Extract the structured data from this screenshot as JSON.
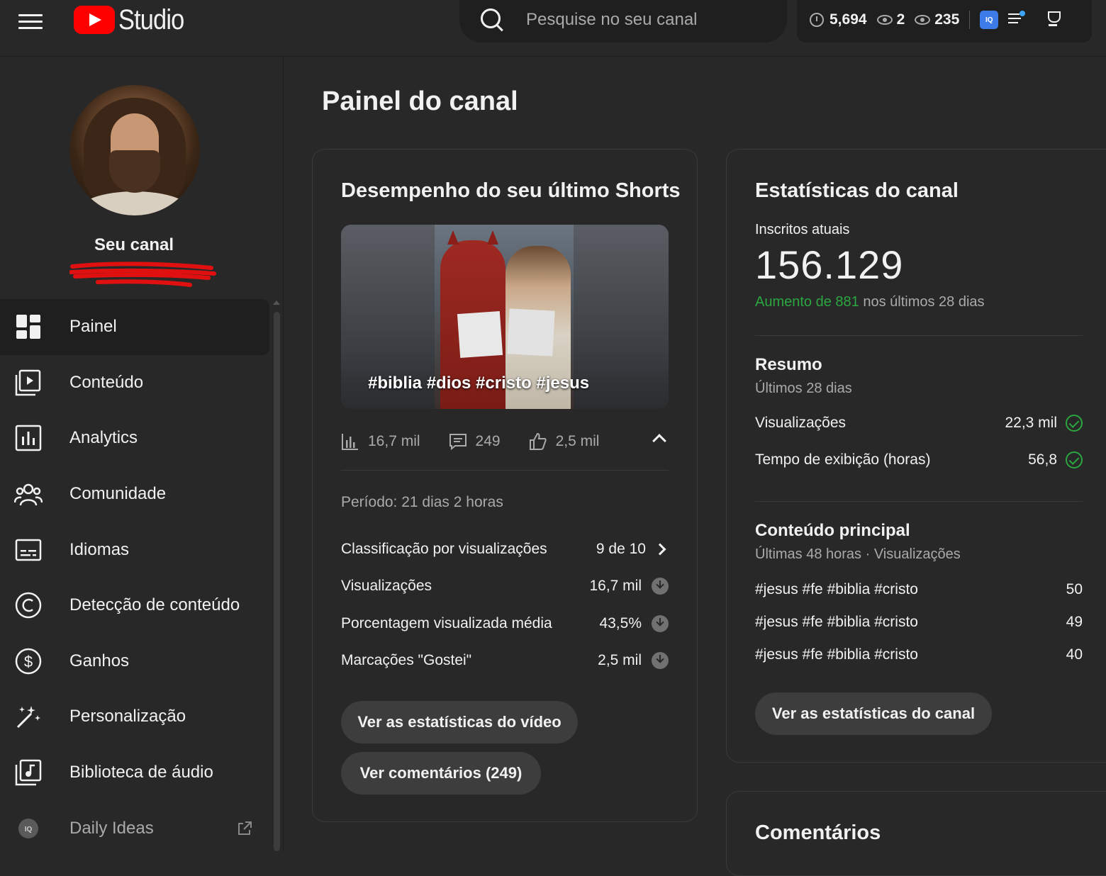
{
  "header": {
    "logo_text": "Studio",
    "search_placeholder": "Pesquise no seu canal",
    "stats": {
      "watch_hours": "5,694",
      "live_viewers": "2",
      "views": "235"
    },
    "iq_badge": "IQ"
  },
  "sidebar": {
    "channel_label": "Seu canal",
    "items": [
      {
        "label": "Painel",
        "icon": "dashboard-icon",
        "active": true
      },
      {
        "label": "Conteúdo",
        "icon": "content-icon"
      },
      {
        "label": "Analytics",
        "icon": "analytics-icon"
      },
      {
        "label": "Comunidade",
        "icon": "community-icon"
      },
      {
        "label": "Idiomas",
        "icon": "subtitles-icon"
      },
      {
        "label": "Detecção de conteúdo",
        "icon": "copyright-icon"
      },
      {
        "label": "Ganhos",
        "icon": "dollar-icon"
      },
      {
        "label": "Personalização",
        "icon": "magic-wand-icon"
      },
      {
        "label": "Biblioteca de áudio",
        "icon": "audio-library-icon"
      },
      {
        "label": "Daily Ideas",
        "icon": "iq-icon"
      }
    ]
  },
  "main": {
    "title": "Painel do canal",
    "shorts_card": {
      "title": "Desempenho do seu último Shorts",
      "thumbnail_caption": "#biblia #dios #cristo #jesus",
      "views": "16,7 mil",
      "comments": "249",
      "likes": "2,5 mil",
      "period": "Período: 21 dias 2 horas",
      "rows": [
        {
          "label": "Classificação por visualizações",
          "value": "9 de 10"
        },
        {
          "label": "Visualizações",
          "value": "16,7 mil"
        },
        {
          "label": "Porcentagem visualizada média",
          "value": "43,5%"
        },
        {
          "label": "Marcações \"Gostei\"",
          "value": "2,5 mil"
        }
      ],
      "btn_video_stats": "Ver as estatísticas do vídeo",
      "btn_comments": "Ver comentários (249)"
    },
    "channel_card": {
      "title": "Estatísticas do canal",
      "subs_label": "Inscritos atuais",
      "subs_count": "156.129",
      "growth_highlight": "Aumento de 881",
      "growth_rest": "nos últimos 28 dias",
      "summary_title": "Resumo",
      "summary_sub": "Últimos 28 dias",
      "summary_rows": [
        {
          "label": "Visualizações",
          "value": "22,3 mil"
        },
        {
          "label": "Tempo de exibição (horas)",
          "value": "56,8"
        }
      ],
      "top_title": "Conteúdo principal",
      "top_sub": "Últimas 48 horas · Visualizações",
      "top_rows": [
        {
          "label": "#jesus #fe #biblia #cristo",
          "value": "50"
        },
        {
          "label": "#jesus #fe #biblia #cristo",
          "value": "49"
        },
        {
          "label": "#jesus #fe #biblia #cristo",
          "value": "40"
        }
      ],
      "btn_channel_stats": "Ver as estatísticas do canal"
    },
    "comments_card": {
      "title": "Comentários"
    }
  }
}
